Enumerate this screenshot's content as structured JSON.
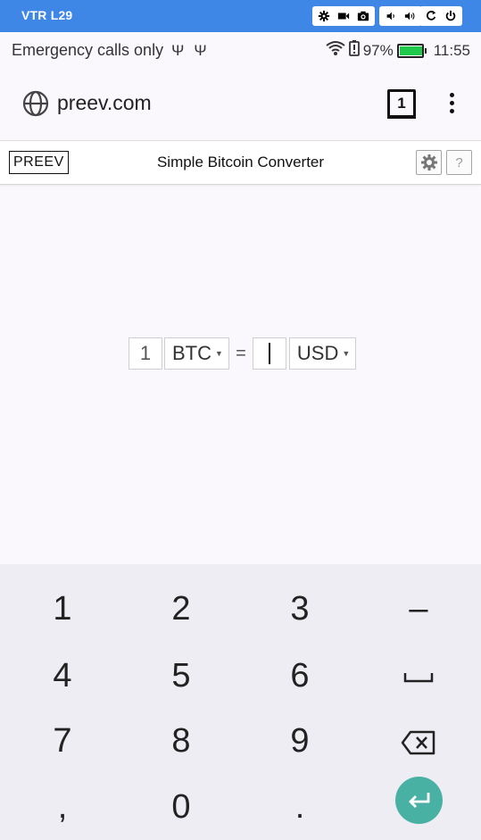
{
  "emulator": {
    "device_name": "VTR L29"
  },
  "status_bar": {
    "left_text": "Emergency calls only",
    "battery_percent": "97%",
    "time": "11:55"
  },
  "browser": {
    "url": "preev.com",
    "tab_count": "1"
  },
  "page": {
    "logo": "PREEV",
    "title": "Simple Bitcoin Converter",
    "help_label": "?"
  },
  "converter": {
    "amount": "1",
    "from_currency": "BTC",
    "equals": "=",
    "to_amount": "",
    "to_currency": "USD"
  },
  "keyboard": {
    "rows": [
      [
        "1",
        "2",
        "3",
        "–"
      ],
      [
        "4",
        "5",
        "6",
        "space"
      ],
      [
        "7",
        "8",
        "9",
        "backspace"
      ],
      [
        ",",
        "0",
        ".",
        "enter"
      ]
    ]
  },
  "colors": {
    "emulator_bar": "#3f87e6",
    "battery_fill": "#1fc94b",
    "enter_key": "#49b1a3",
    "keyboard_bg": "#eeedf3"
  }
}
